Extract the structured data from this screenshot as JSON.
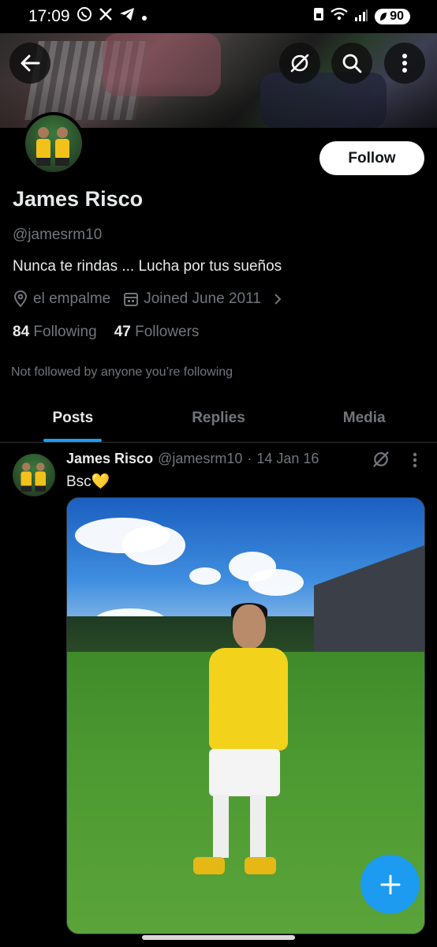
{
  "status_bar": {
    "time": "17:09",
    "battery": "90"
  },
  "header": {
    "back_icon": "arrow-left-icon",
    "grok_icon": "grok-icon",
    "search_icon": "search-icon",
    "more_icon": "more-vertical-icon"
  },
  "profile": {
    "name": "James Risco",
    "handle": "@jamesrm10",
    "bio": "Nunca te rindas ... Lucha por tus sueños",
    "location": "el empalme",
    "joined": "Joined June 2011",
    "following_count": "84",
    "following_label": "Following",
    "followers_count": "47",
    "followers_label": "Followers",
    "not_followed": "Not followed by anyone you’re following",
    "follow_label": "Follow"
  },
  "tabs": [
    {
      "label": "Posts",
      "active": true
    },
    {
      "label": "Replies",
      "active": false
    },
    {
      "label": "Media",
      "active": false
    }
  ],
  "post": {
    "author": "James Risco",
    "handle": "@jamesrm10",
    "separator": "·",
    "date": "14 Jan 16",
    "text": "Bsc💛"
  },
  "colors": {
    "accent": "#1d9bf0",
    "background": "#000000",
    "secondary_text": "#71767b"
  }
}
